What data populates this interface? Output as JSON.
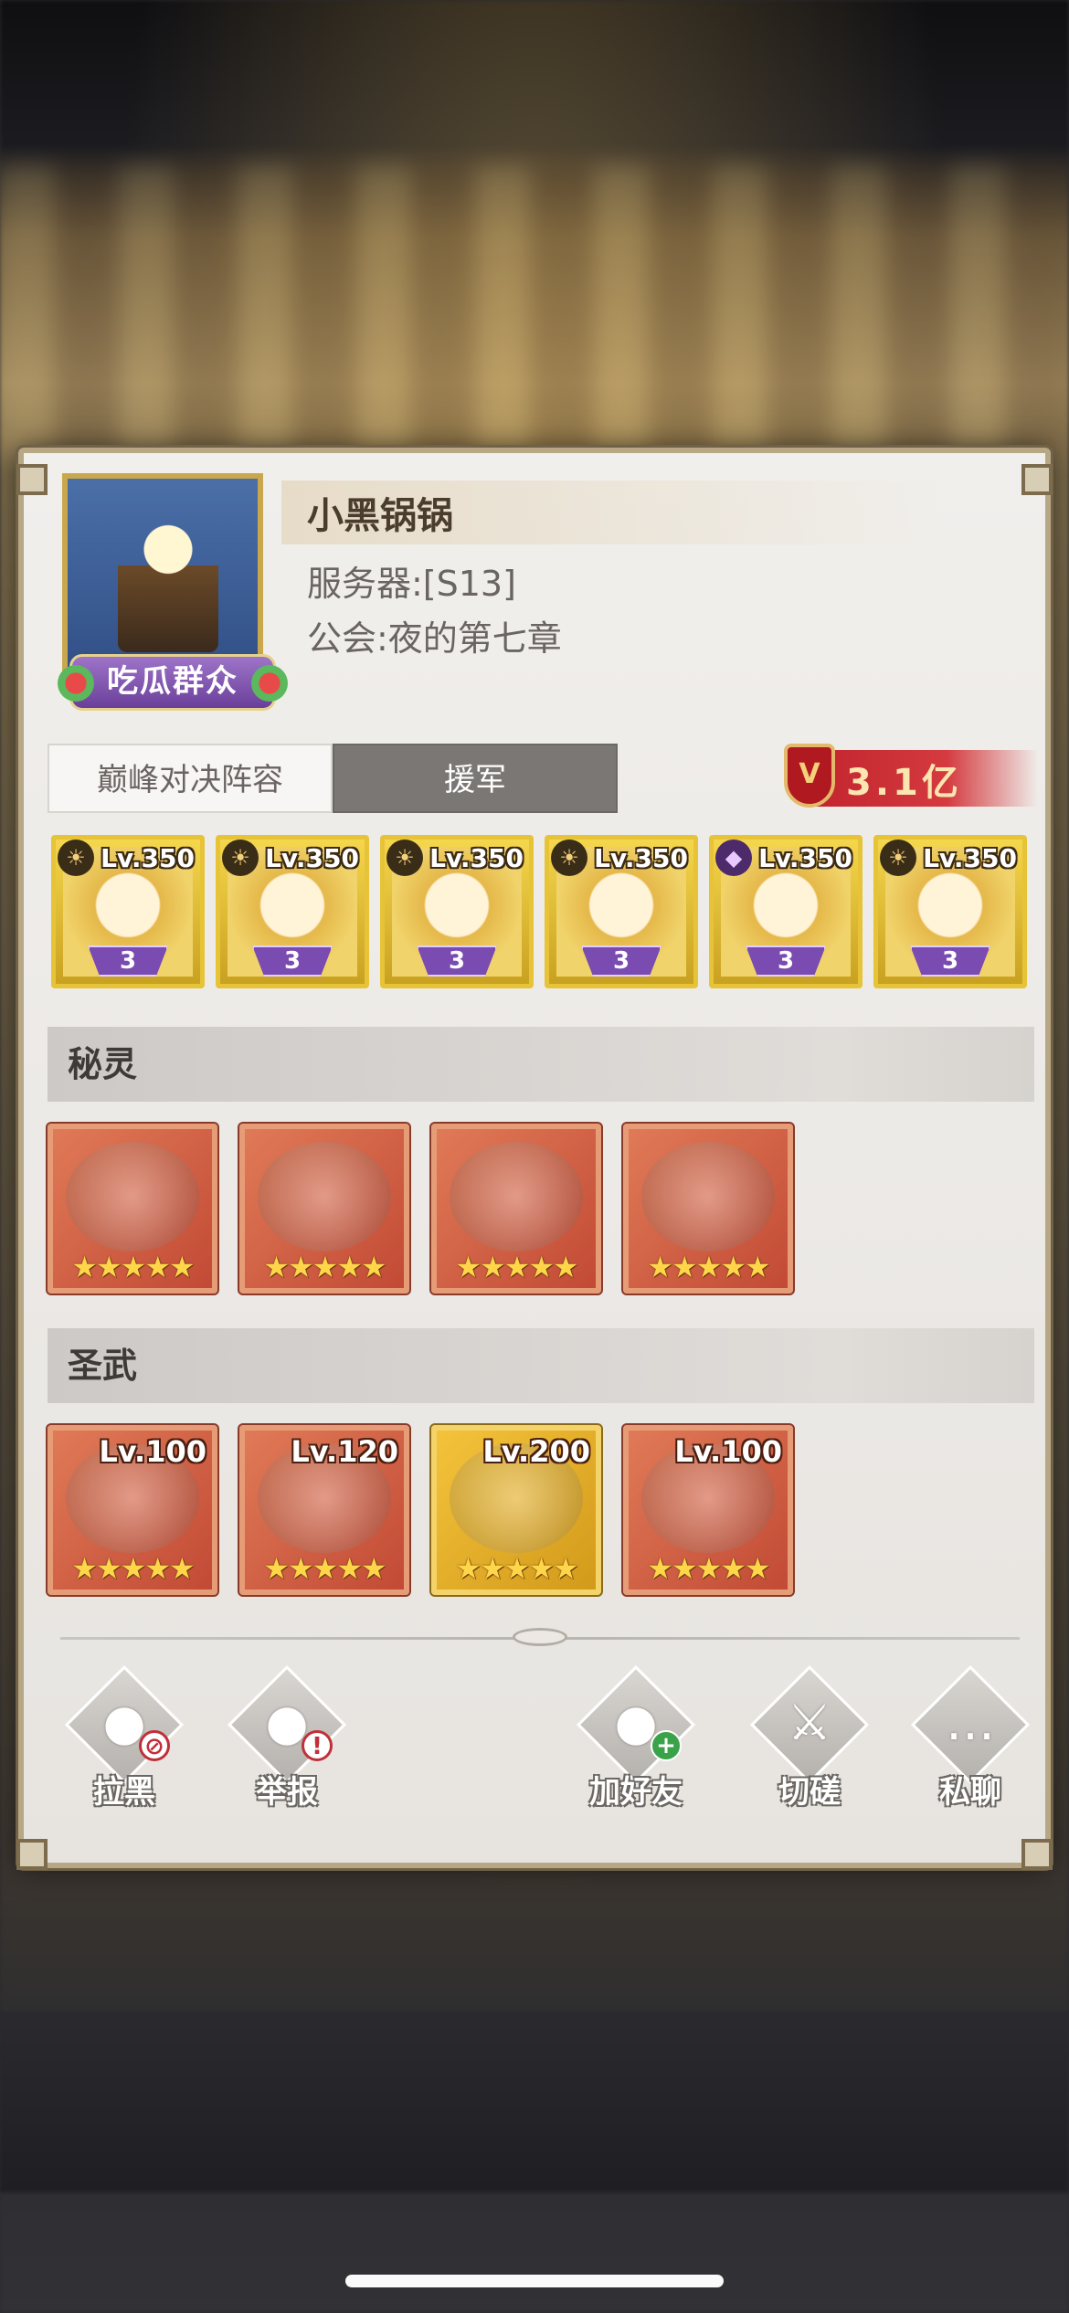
{
  "player": {
    "name": "小黑锅锅",
    "server": "服务器:[S13]",
    "guild": "公会:夜的第七章",
    "badge": "吃瓜群众"
  },
  "tabs": [
    {
      "label": "巅峰对决阵容",
      "active": false
    },
    {
      "label": "援军",
      "active": true
    }
  ],
  "power": "3.1亿",
  "heroes": [
    {
      "level": "Lv.350",
      "rank": "3",
      "element": "light-icon"
    },
    {
      "level": "Lv.350",
      "rank": "3",
      "element": "light-icon"
    },
    {
      "level": "Lv.350",
      "rank": "3",
      "element": "light-icon"
    },
    {
      "level": "Lv.350",
      "rank": "3",
      "element": "light-icon"
    },
    {
      "level": "Lv.350",
      "rank": "3",
      "element": "dark-icon"
    },
    {
      "level": "Lv.350",
      "rank": "3",
      "element": "light-icon"
    }
  ],
  "sections": {
    "spirits_title": "秘灵",
    "weapons_title": "圣武"
  },
  "spirits": [
    {
      "stars": "★★★★★",
      "name": "shadow-rabbit"
    },
    {
      "stars": "★★★★★",
      "name": "turtle-dragon"
    },
    {
      "stars": "★★★★★",
      "name": "golden-lion"
    },
    {
      "stars": "★★★★★",
      "name": "white-dragon"
    }
  ],
  "weapons": [
    {
      "level": "Lv.100",
      "stars": "★★★★★",
      "gold": false
    },
    {
      "level": "Lv.120",
      "stars": "★★★★★",
      "gold": false
    },
    {
      "level": "Lv.200",
      "stars": "★★★★★",
      "gold": true
    },
    {
      "level": "Lv.100",
      "stars": "★★★★★",
      "gold": false
    }
  ],
  "actions": {
    "block": "拉黑",
    "report": "举报",
    "add_friend": "加好友",
    "duel": "切磋",
    "chat": "私聊"
  }
}
